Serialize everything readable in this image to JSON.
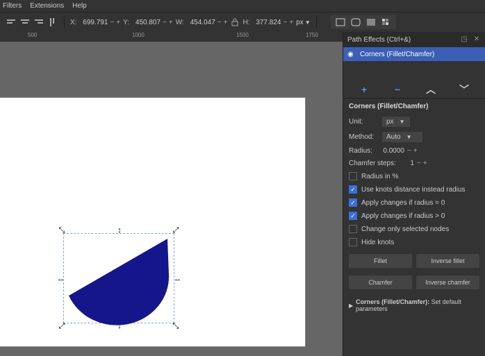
{
  "menu": {
    "filters": "Filters",
    "extensions": "Extensions",
    "help": "Help"
  },
  "toolbar": {
    "x_label": "X:",
    "x_val": "699.791",
    "y_label": "Y:",
    "y_val": "450.807",
    "w_label": "W:",
    "w_val": "454.047",
    "h_label": "H:",
    "h_val": "377.824",
    "unit": "px"
  },
  "ruler": {
    "t0": "500",
    "t1": "1000",
    "t2": "1500",
    "t3": "1750"
  },
  "panel": {
    "title": "Path Effects (Ctrl+&)",
    "effect_name": "Corners (Fillet/Chamfer)",
    "section": "Corners (Fillet/Chamfer)",
    "unit_lab": "Unit:",
    "unit_val": "px",
    "method_lab": "Method:",
    "method_val": "Auto",
    "radius_lab": "Radius:",
    "radius_val": "0.0000",
    "chamfer_lab": "Chamfer steps:",
    "chamfer_val": "1",
    "chk_radius_pct": "Radius in %",
    "chk_knots": "Use knots distance instead radius",
    "chk_apply_eq": "Apply changes if radius = 0",
    "chk_apply_gt": "Apply changes if radius > 0",
    "chk_sel_only": "Change only selected nodes",
    "chk_hide": "Hide knots",
    "btn_fillet": "Fillet",
    "btn_inv_fillet": "Inverse fillet",
    "btn_chamfer": "Chamfer",
    "btn_inv_chamfer": "Inverse chamfer",
    "defaults_pre": "Corners (Fillet/Chamfer):",
    "defaults_txt": " Set default parameters"
  }
}
